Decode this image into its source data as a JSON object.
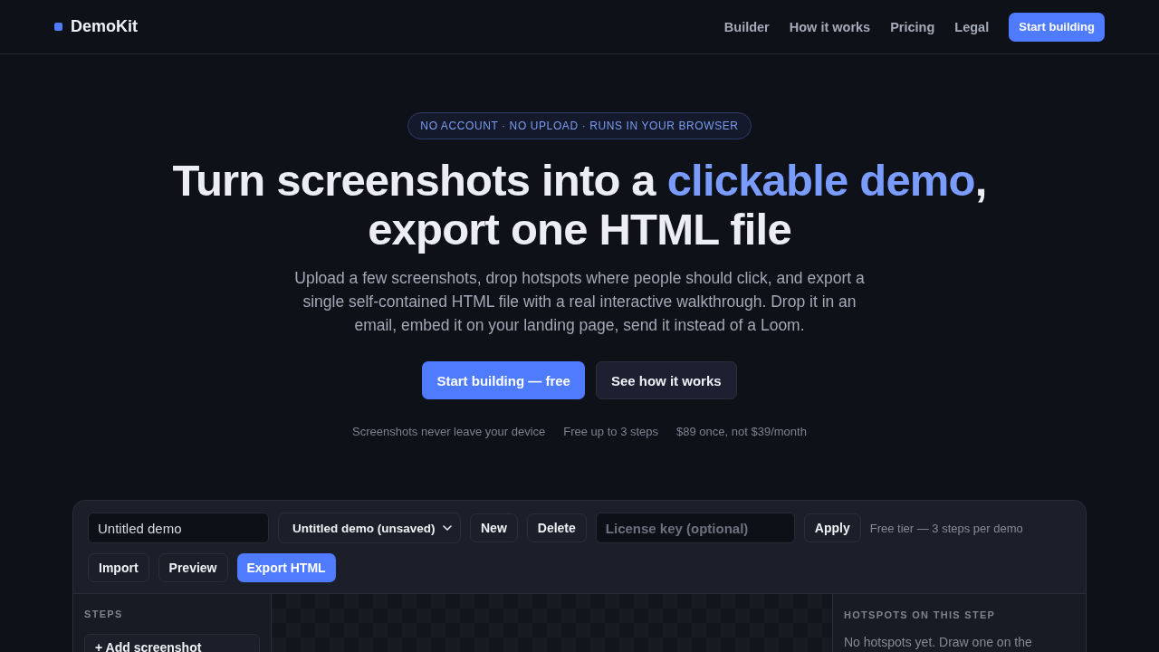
{
  "nav": {
    "brand": "DemoKit",
    "links": [
      {
        "label": "Builder"
      },
      {
        "label": "How it works"
      },
      {
        "label": "Pricing"
      },
      {
        "label": "Legal"
      }
    ],
    "cta": "Start building"
  },
  "hero": {
    "badge": "NO ACCOUNT · NO UPLOAD · RUNS IN YOUR BROWSER",
    "headline": [
      {
        "text": "Turn screenshots into a ",
        "kind": "plain"
      },
      {
        "text": "clickable demo",
        "kind": "accent"
      },
      {
        "text": ", export one HTML file",
        "kind": "plain"
      }
    ],
    "lead": "Upload a few screenshots, drop hotspots where people should click, and export a single self-contained HTML file with a real interactive walkthrough. Drop it in an email, embed it on your landing page, send it instead of a Loom.",
    "actions": [
      {
        "label": "Start building — free",
        "kind": "primary"
      },
      {
        "label": "See how it works",
        "kind": "secondary"
      }
    ],
    "notes": [
      "Screenshots never leave your device",
      "Free up to 3 steps",
      "$89 once, not $39/month"
    ]
  },
  "builder": {
    "title_field": {
      "value": "Untitled demo"
    },
    "demo_select": {
      "value": "Untitled demo (unsaved)"
    },
    "row1_buttons": [
      {
        "label": "New",
        "kind": "secondary"
      },
      {
        "label": "Delete",
        "kind": "secondary"
      }
    ],
    "license_field": {
      "placeholder": "License key (optional)"
    },
    "apply_button": {
      "label": "Apply",
      "kind": "secondary"
    },
    "tier_note": "Free tier — 3 steps per demo",
    "row2_buttons": [
      {
        "label": "Import",
        "kind": "secondary"
      },
      {
        "label": "Preview",
        "kind": "secondary"
      },
      {
        "label": "Export HTML",
        "kind": "primary"
      }
    ],
    "steps": {
      "heading": "STEPS",
      "add_button": "+ Add screenshot"
    },
    "hotspots": {
      "heading": "HOTSPOTS ON THIS STEP",
      "empty_text": "No hotspots yet. Draw one on the"
    }
  }
}
